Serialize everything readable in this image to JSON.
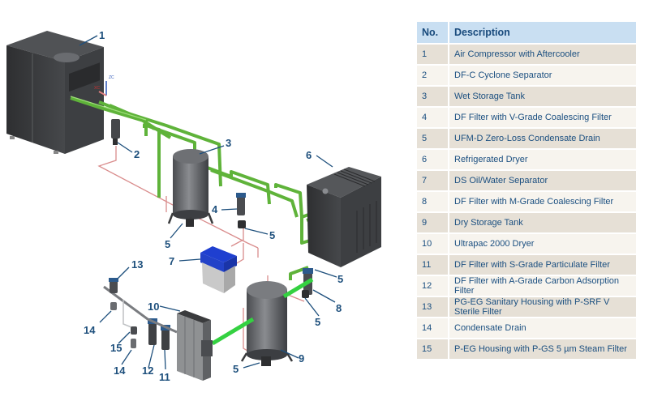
{
  "legend": {
    "header": {
      "number": "No.",
      "description": "Description"
    },
    "rows": [
      {
        "number": "1",
        "description": "Air Compressor with Aftercooler"
      },
      {
        "number": "2",
        "description": "DF-C Cyclone Separator"
      },
      {
        "number": "3",
        "description": "Wet Storage Tank"
      },
      {
        "number": "4",
        "description": "DF Filter with V-Grade Coalescing Filter"
      },
      {
        "number": "5",
        "description": "UFM-D Zero-Loss Condensate Drain"
      },
      {
        "number": "6",
        "description": "Refrigerated Dryer"
      },
      {
        "number": "7",
        "description": "DS Oil/Water Separator"
      },
      {
        "number": "8",
        "description": "DF Filter with M-Grade Coalescing Filter"
      },
      {
        "number": "9",
        "description": "Dry Storage Tank"
      },
      {
        "number": "10",
        "description": "Ultrapac 2000 Dryer"
      },
      {
        "number": "11",
        "description": "DF Filter with S-Grade Particulate Filter"
      },
      {
        "number": "12",
        "description": "DF Filter with A-Grade Carbon Adsorption Filter"
      },
      {
        "number": "13",
        "description": "PG-EG Sanitary Housing with P-SRF V Sterile Filter"
      },
      {
        "number": "14",
        "description": "Condensate Drain"
      },
      {
        "number": "15",
        "description": "P-EG Housing with P-GS 5 µm Steam Filter"
      }
    ]
  },
  "diagram": {
    "axis_labels": {
      "z": "ZC",
      "x": "XC"
    },
    "callouts": {
      "c1": "1",
      "c2": "2",
      "c3": "3",
      "c4": "4",
      "c5a": "5",
      "c5b": "5",
      "c6": "6",
      "c7": "7",
      "c5c": "5",
      "c8": "8",
      "c5d": "5",
      "c9": "9",
      "c5e": "5",
      "c10": "10",
      "c11": "11",
      "c12": "12",
      "c13": "13",
      "c14a": "14",
      "c15": "15",
      "c14b": "14"
    }
  },
  "colors": {
    "header_bg": "#c9dff2",
    "row_odd": "#e6e0d6",
    "row_even": "#f7f4ee",
    "text": "#1b4f80",
    "pipe": "#5fb33a",
    "drain_line": "#d98c8c",
    "machine": "#3a3b3d"
  }
}
